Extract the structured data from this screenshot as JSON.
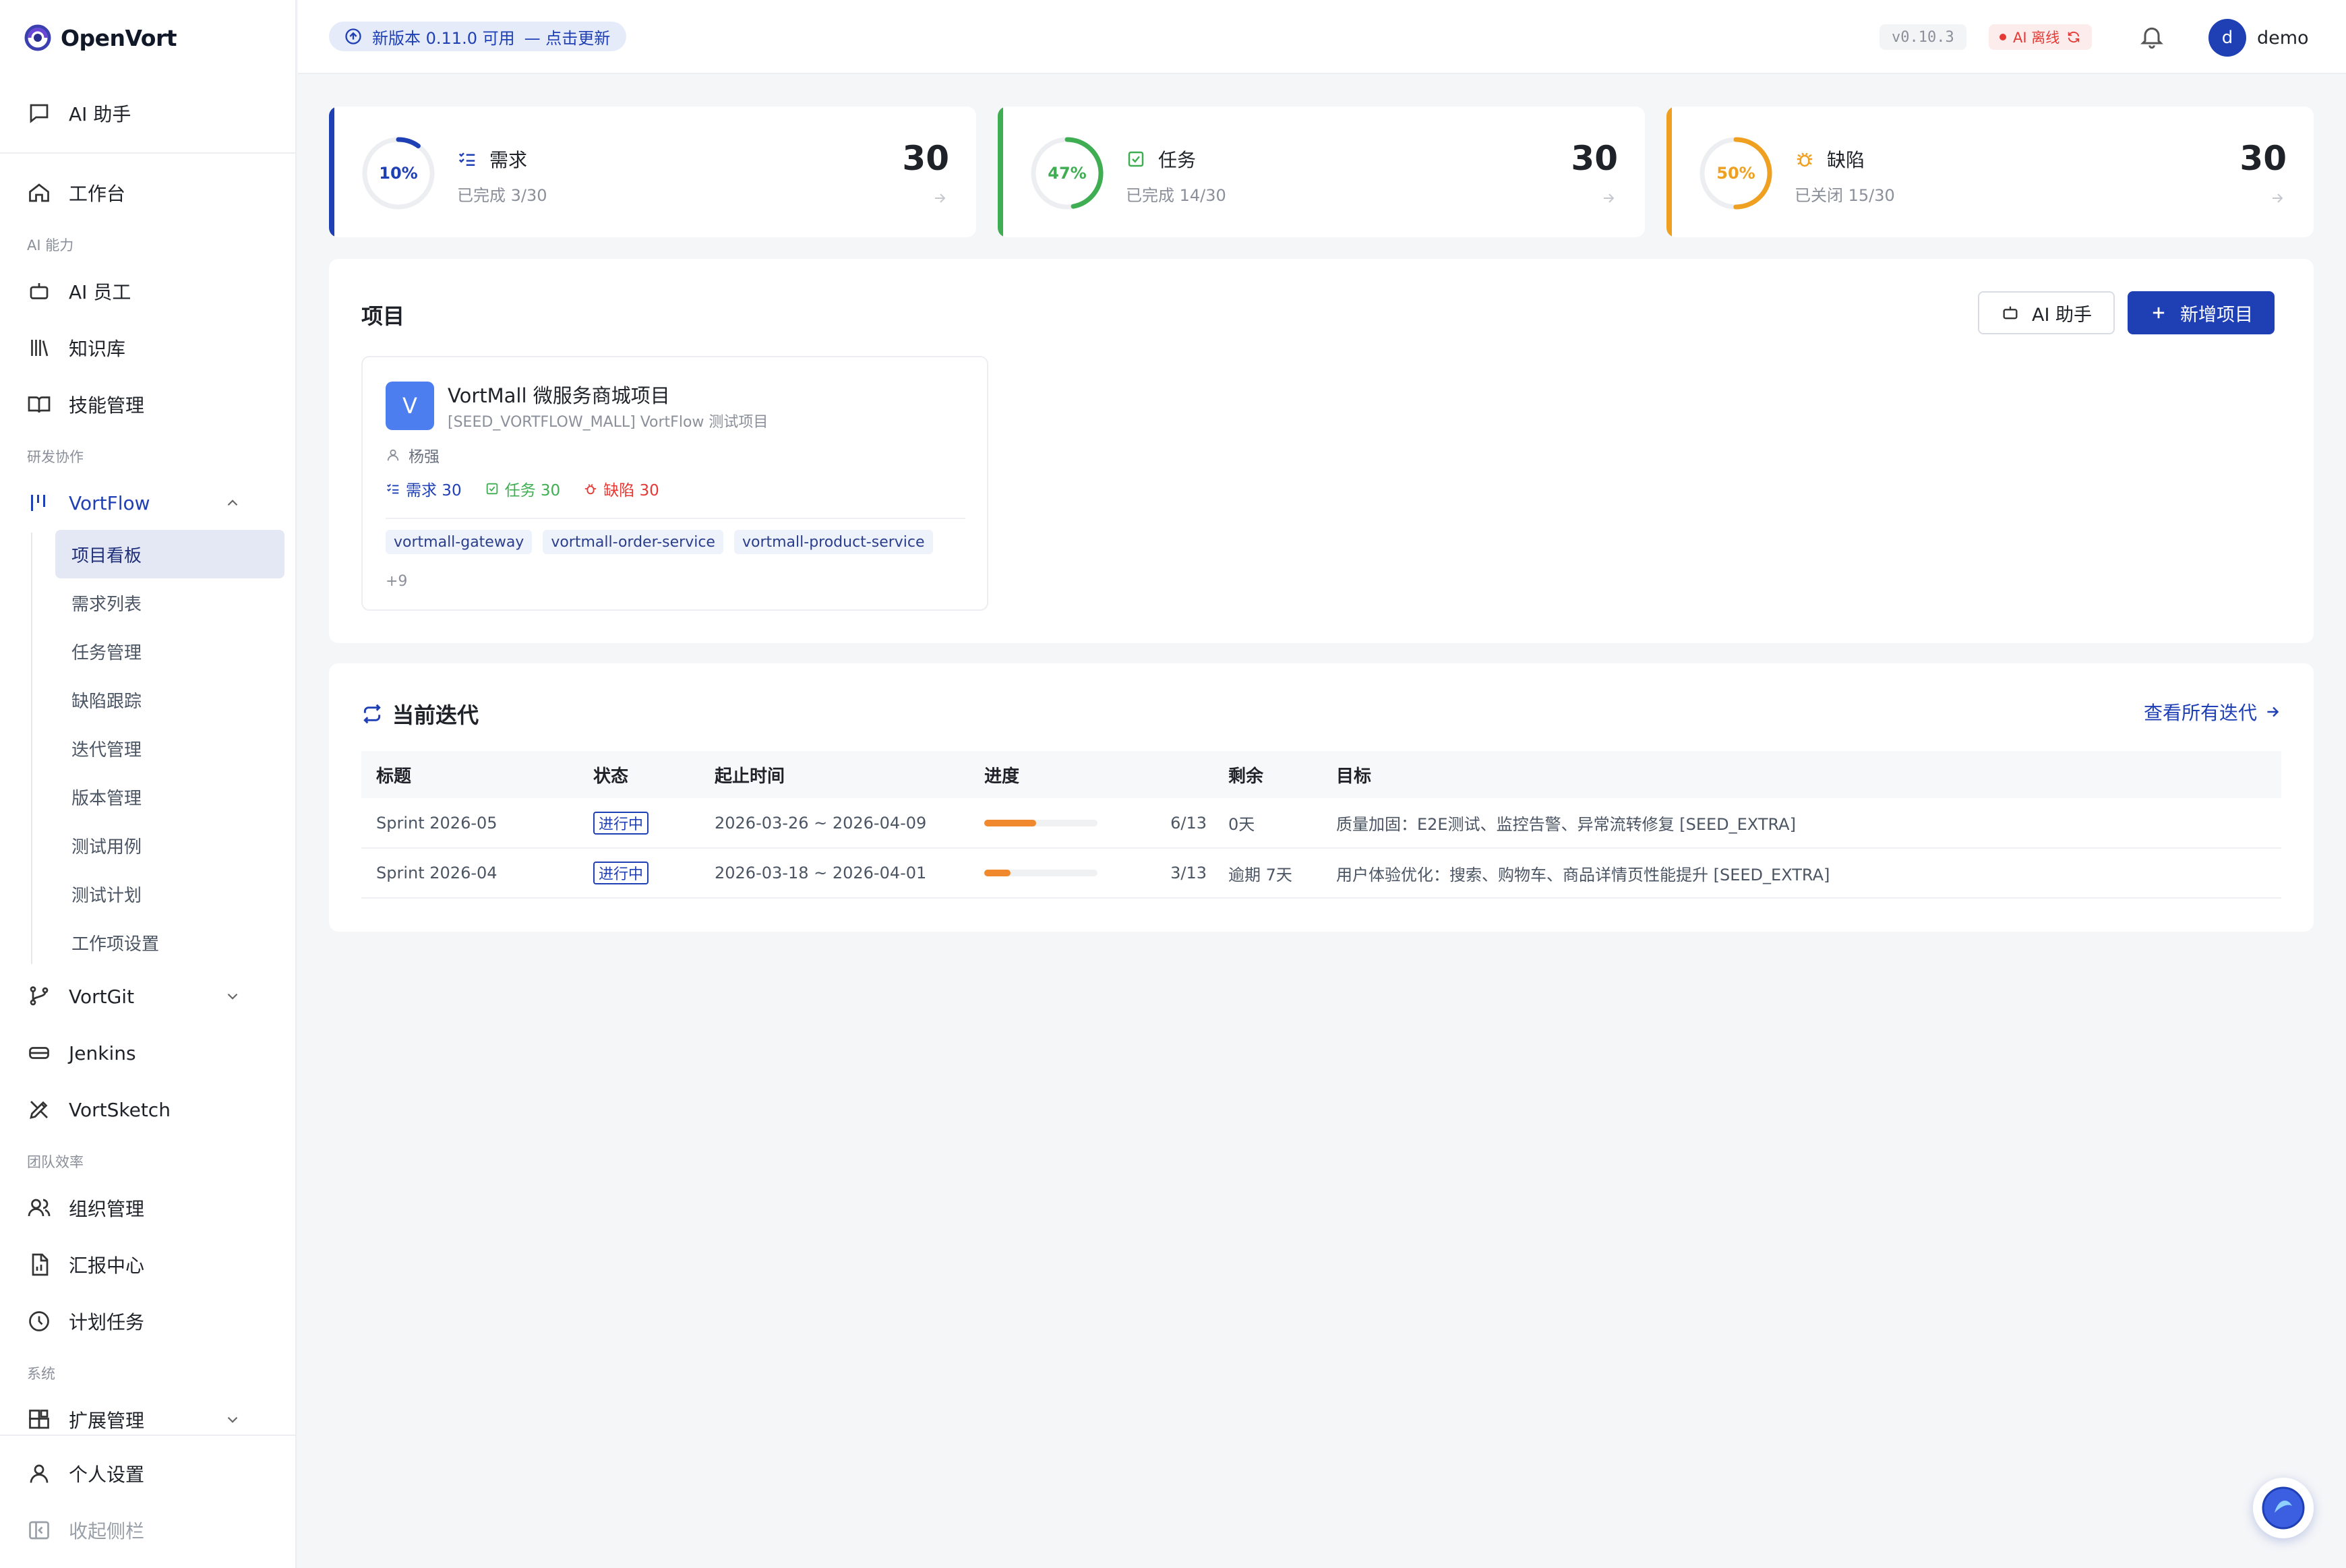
{
  "app": {
    "name": "OpenVort"
  },
  "sidebar": {
    "ai_assistant": "AI 助手",
    "workbench": "工作台",
    "section_ai": "AI 能力",
    "ai_staff": "AI 员工",
    "knowledge": "知识库",
    "skills": "技能管理",
    "section_dev": "研发协作",
    "vortflow": "VortFlow",
    "vortflow_sub": [
      "项目看板",
      "需求列表",
      "任务管理",
      "缺陷跟踪",
      "迭代管理",
      "版本管理",
      "测试用例",
      "测试计划",
      "工作项设置"
    ],
    "vortgit": "VortGit",
    "jenkins": "Jenkins",
    "vortsketch": "VortSketch",
    "section_team": "团队效率",
    "org": "组织管理",
    "reports": "汇报中心",
    "scheduled": "计划任务",
    "section_system": "系统",
    "extensions": "扩展管理",
    "personal": "个人设置",
    "collapse": "收起侧栏"
  },
  "topbar": {
    "update_text": "新版本 0.11.0 可用",
    "update_action": "— 点击更新",
    "version": "v0.10.3",
    "ai_status": "AI 离线",
    "user_initial": "d",
    "username": "demo"
  },
  "stats": [
    {
      "label": "需求",
      "percent_text": "10%",
      "percent": 0.1,
      "sub": "已完成 3/30",
      "count": "30",
      "color": "#1f3fb5"
    },
    {
      "label": "任务",
      "percent_text": "47%",
      "percent": 0.47,
      "sub": "已完成 14/30",
      "count": "30",
      "color": "#3fae52"
    },
    {
      "label": "缺陷",
      "percent_text": "50%",
      "percent": 0.5,
      "sub": "已关闭 15/30",
      "count": "30",
      "color": "#f0a020"
    }
  ],
  "projects": {
    "title": "项目",
    "ai_button": "AI 助手",
    "add_button": "新增项目",
    "card": {
      "logo_letter": "V",
      "name": "VortMall 微服务商城项目",
      "desc": "[SEED_VORTFLOW_MALL] VortFlow 测试项目",
      "owner": "杨强",
      "req": "需求 30",
      "task": "任务 30",
      "bug": "缺陷 30",
      "tags": [
        "vortmall-gateway",
        "vortmall-order-service",
        "vortmall-product-service"
      ],
      "more": "+9"
    }
  },
  "iterations": {
    "title": "当前迭代",
    "view_all": "查看所有迭代",
    "headers": [
      "标题",
      "状态",
      "起止时间",
      "进度",
      "剩余",
      "目标"
    ],
    "rows": [
      {
        "title": "Sprint 2026-05",
        "status": "进行中",
        "dates": "2026-03-26 ~ 2026-04-09",
        "progress": 0.46,
        "progress_text": "6/13",
        "remaining": "0天",
        "goal": "质量加固：E2E测试、监控告警、异常流转修复 [SEED_EXTRA]"
      },
      {
        "title": "Sprint 2026-04",
        "status": "进行中",
        "dates": "2026-03-18 ~ 2026-04-01",
        "progress": 0.23,
        "progress_text": "3/13",
        "remaining": "逾期 7天",
        "goal": "用户体验优化：搜索、购物车、商品详情页性能提升 [SEED_EXTRA]"
      }
    ]
  }
}
